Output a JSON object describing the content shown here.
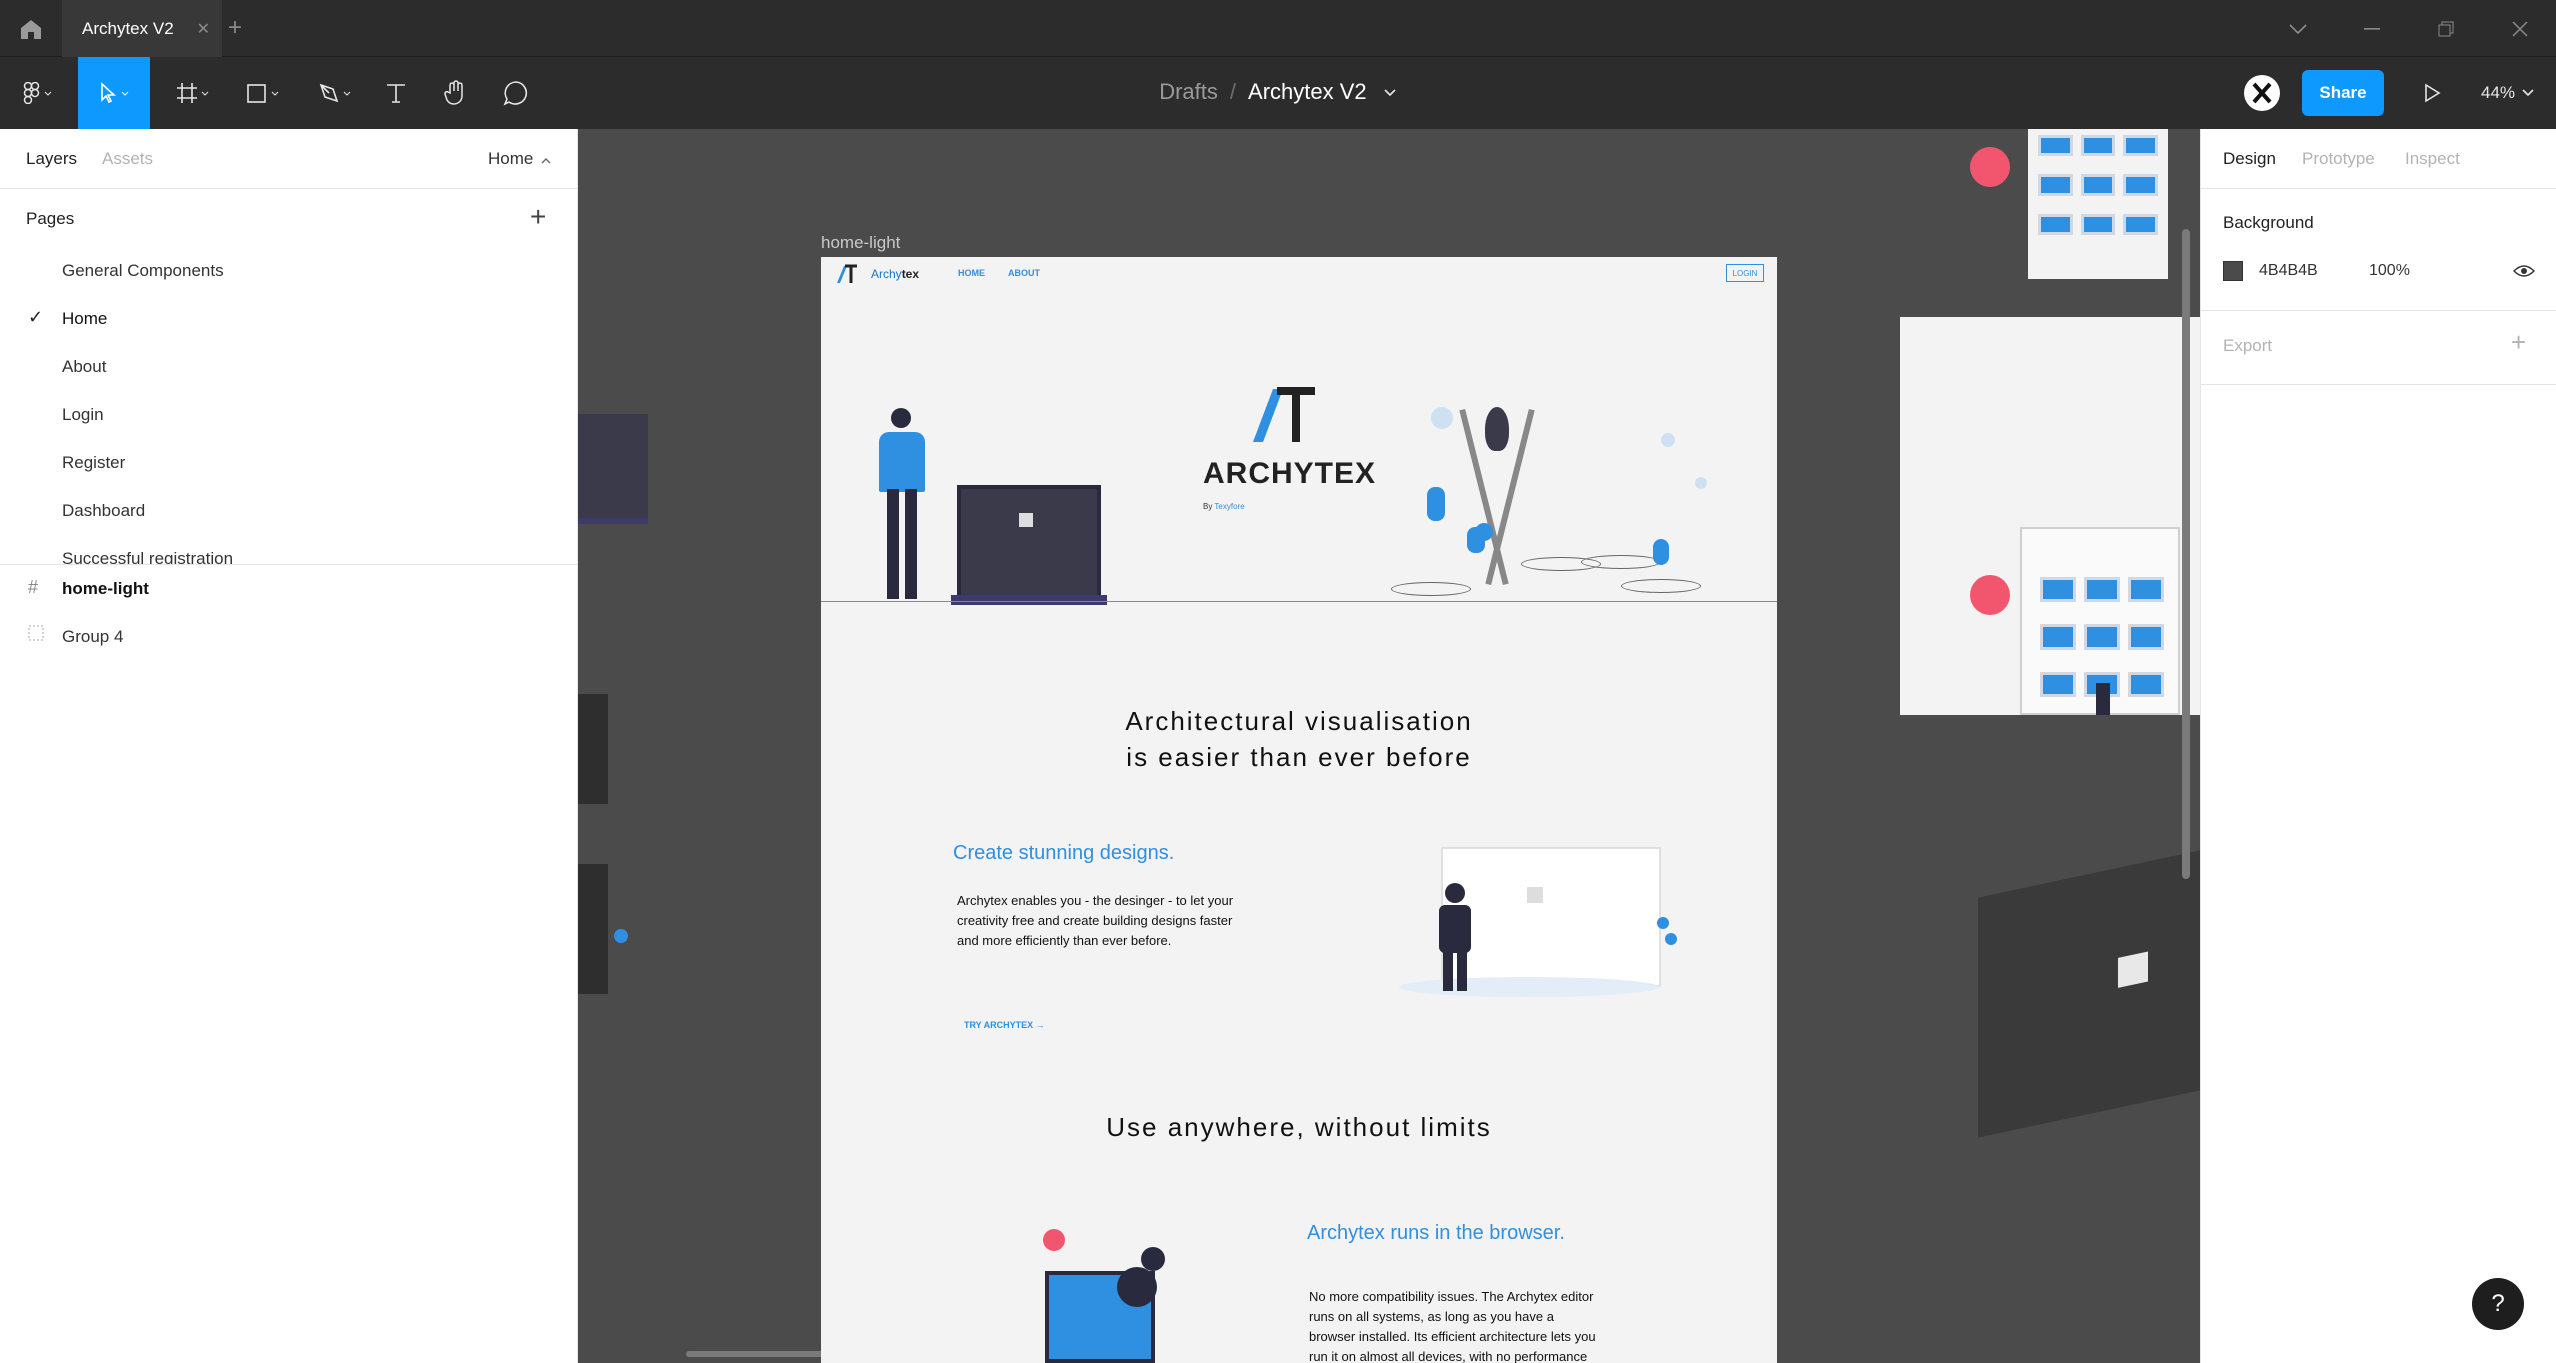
{
  "app": {
    "tab_title": "Archytex V2"
  },
  "toolbar": {
    "breadcrumb_parent": "Drafts",
    "breadcrumb_sep": "/",
    "breadcrumb_current": "Archytex V2",
    "share_label": "Share",
    "zoom": "44%"
  },
  "left_panel": {
    "tab_layers": "Layers",
    "tab_assets": "Assets",
    "current_page": "Home",
    "pages_header": "Pages",
    "pages": [
      {
        "label": "General Components",
        "active": false
      },
      {
        "label": "Home",
        "active": true
      },
      {
        "label": "About",
        "active": false
      },
      {
        "label": "Login",
        "active": false
      },
      {
        "label": "Register",
        "active": false
      },
      {
        "label": "Dashboard",
        "active": false
      },
      {
        "label": "Successful registration",
        "active": false
      }
    ],
    "layers": [
      {
        "label": "home-light",
        "icon": "frame-icon"
      },
      {
        "label": "Group 4",
        "icon": "group-icon"
      }
    ]
  },
  "right_panel": {
    "tab_design": "Design",
    "tab_prototype": "Prototype",
    "tab_inspect": "Inspect",
    "background_label": "Background",
    "background_hex": "4B4B4B",
    "background_opacity": "100%",
    "export_label": "Export"
  },
  "canvas": {
    "frame_label": "home-light",
    "nav": {
      "brand_a": "Archy",
      "brand_b": "tex",
      "home": "HOME",
      "about": "ABOUT",
      "login": "LOGIN"
    },
    "hero": {
      "logo": "ARCHYTEX",
      "by": "By",
      "by_name": "Texyfore"
    },
    "headline_1": "Architectural visualisation",
    "headline_2": "is easier than ever before",
    "section1": {
      "heading": "Create stunning designs.",
      "body_1": "Archytex enables you - the desinger - to let your",
      "body_2": "creativity free and create building designs faster",
      "body_3": "and more efficiently than ever before.",
      "cta": "TRY ARCHYTEX"
    },
    "headline_3": "Use anywhere, without limits",
    "section2": {
      "heading": "Archytex runs in the browser.",
      "body_1": "No more compatibility issues. The Archytex editor",
      "body_2": "runs on all systems, as long as you have a",
      "body_3": "browser installed. Its efficient architecture lets you",
      "body_4": "run it on almost all devices, with no performance"
    }
  },
  "colors": {
    "accent": "#0d99ff",
    "brand_blue": "#2f8fe0",
    "canvas_bg": "#4b4b4b",
    "chrome_bg": "#2c2c2c",
    "pink": "#f2566f"
  },
  "help_label": "?"
}
